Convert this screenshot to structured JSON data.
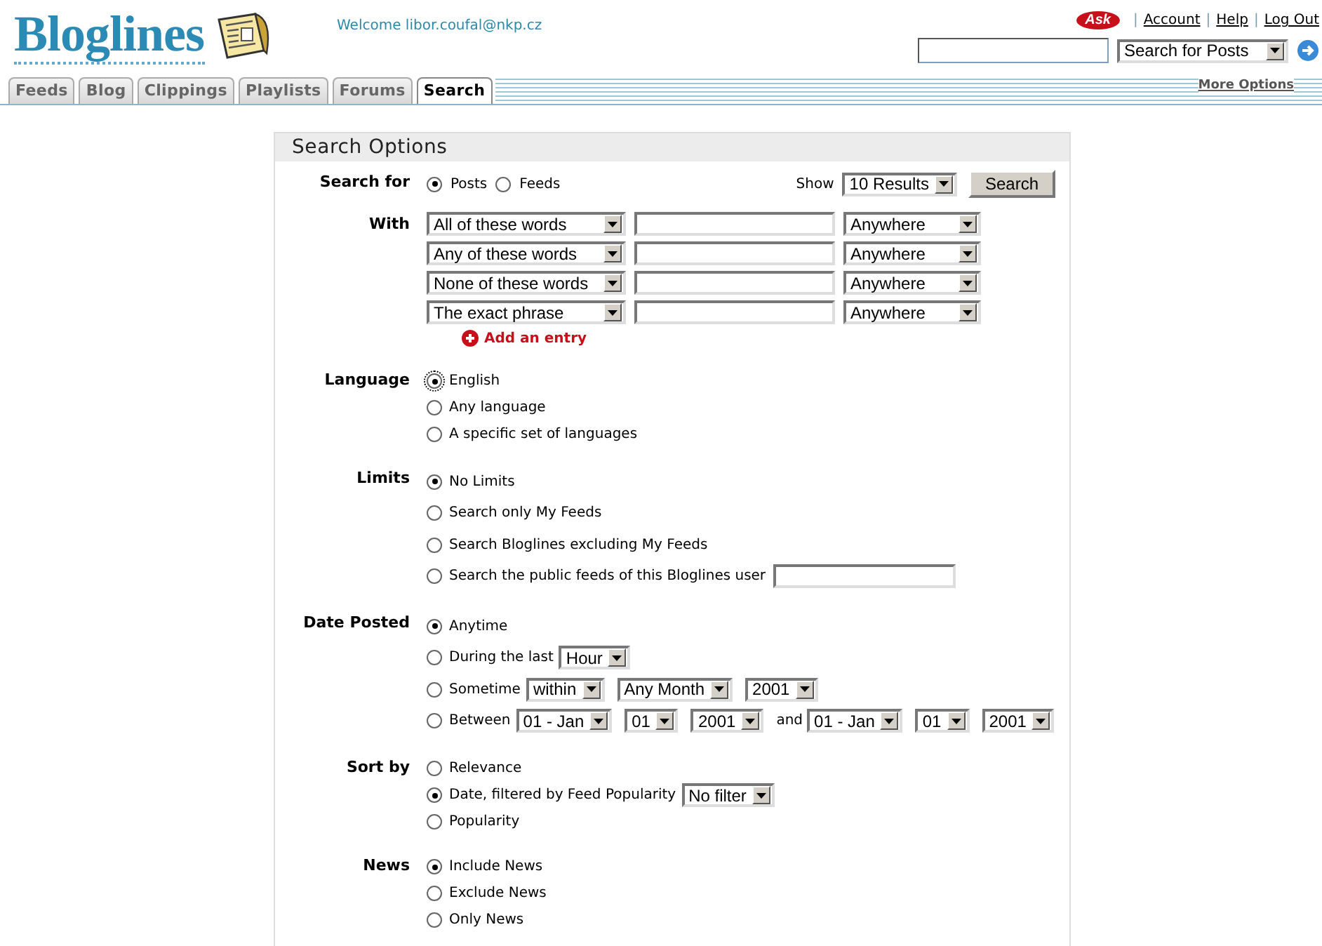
{
  "header": {
    "logo": "Bloglines",
    "welcome": "Welcome libor.coufal@nkp.cz",
    "link_separator": "|",
    "ask_logo": "Ask",
    "links": [
      "Account",
      "Help",
      "Log Out"
    ],
    "quick_search": {
      "select": "Search for Posts",
      "more_options": "More Options"
    }
  },
  "tabs": [
    {
      "label": "Feeds",
      "selected": false
    },
    {
      "label": "Blog",
      "selected": false
    },
    {
      "label": "Clippings",
      "selected": false
    },
    {
      "label": "Playlists",
      "selected": false
    },
    {
      "label": "Forums",
      "selected": false
    },
    {
      "label": "Search",
      "selected": true
    }
  ],
  "panel": {
    "title": "Search Options",
    "search_for": {
      "label": "Search for",
      "options": [
        {
          "label": "Posts",
          "selected": true
        },
        {
          "label": "Feeds",
          "selected": false
        }
      ],
      "show_label": "Show",
      "show_select": "10 Results",
      "button": "Search"
    },
    "with": {
      "label": "With",
      "rows": [
        {
          "mode": "All of these words",
          "location": "Anywhere"
        },
        {
          "mode": "Any of these words",
          "location": "Anywhere"
        },
        {
          "mode": "None of these words",
          "location": "Anywhere"
        },
        {
          "mode": "The exact phrase",
          "location": "Anywhere"
        }
      ],
      "add": "Add an entry"
    },
    "sections": [
      {
        "label": "Language",
        "options": [
          {
            "label": "English",
            "selected": true,
            "focused": true
          },
          {
            "label": "Any language",
            "selected": false
          },
          {
            "label": "A specific set of languages",
            "selected": false
          }
        ]
      },
      {
        "label": "Limits",
        "options": [
          {
            "label": "No Limits",
            "selected": true
          },
          {
            "label": "Search only My Feeds",
            "selected": false
          },
          {
            "label": "Search Bloglines excluding My Feeds",
            "selected": false
          },
          {
            "label": "Search the public feeds of this Bloglines user",
            "selected": false,
            "extras": [
              {
                "kind": "field"
              }
            ]
          }
        ]
      },
      {
        "label": "Date Posted",
        "options": [
          {
            "label": "Anytime",
            "selected": true
          },
          {
            "label": "During the last",
            "selected": false,
            "extras": [
              {
                "kind": "select",
                "value": "Hour"
              }
            ]
          },
          {
            "label": "Sometime",
            "selected": false,
            "extras": [
              {
                "kind": "select",
                "value": "within"
              },
              {
                "kind": "select",
                "value": "Any Month"
              },
              {
                "kind": "select",
                "value": "2001"
              }
            ]
          },
          {
            "label": "Between",
            "selected": false,
            "extras": [
              {
                "kind": "select",
                "value": "01 - Jan"
              },
              {
                "kind": "select",
                "value": "01"
              },
              {
                "kind": "select",
                "value": "2001"
              },
              {
                "kind": "text",
                "text": "and"
              },
              {
                "kind": "select",
                "value": "01 - Jan"
              },
              {
                "kind": "select",
                "value": "01"
              },
              {
                "kind": "select",
                "value": "2001"
              }
            ]
          }
        ]
      },
      {
        "label": "Sort by",
        "options": [
          {
            "label": "Relevance",
            "selected": false
          },
          {
            "label": "Date, filtered by Feed Popularity",
            "selected": true,
            "extras": [
              {
                "kind": "select",
                "value": "No filter"
              }
            ]
          },
          {
            "label": "Popularity",
            "selected": false
          }
        ]
      },
      {
        "label": "News",
        "options": [
          {
            "label": "Include News",
            "selected": true
          },
          {
            "label": "Exclude News",
            "selected": false
          },
          {
            "label": "Only News",
            "selected": false
          }
        ]
      }
    ]
  }
}
